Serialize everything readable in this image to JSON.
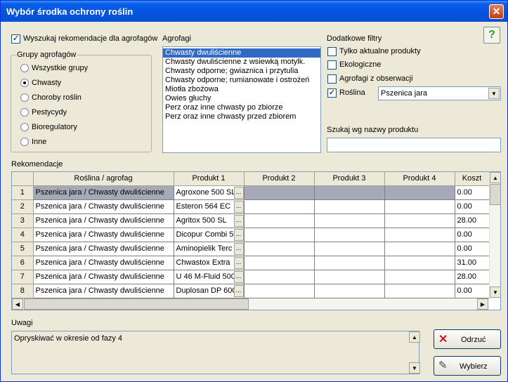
{
  "window": {
    "title": "Wybór środka ochrony roślin",
    "close_glyph": "✕"
  },
  "search_reco_checkbox": {
    "label": "Wyszukaj rekomendacje dla agrofagów",
    "checked": true
  },
  "help_button": {
    "glyph": "?"
  },
  "groups": {
    "title": "Grupy agrofagów",
    "options": [
      {
        "label": "Wszystkie grupy",
        "selected": false
      },
      {
        "label": "Chwasty",
        "selected": true
      },
      {
        "label": "Choroby roślin",
        "selected": false
      },
      {
        "label": "Pestycydy",
        "selected": false
      },
      {
        "label": "Bioregulatory",
        "selected": false
      },
      {
        "label": "Inne",
        "selected": false
      }
    ]
  },
  "agrofagi": {
    "title": "Agrofagi",
    "items": [
      "Chwasty dwuliścienne",
      "Chwasty dwuliścienne z wsiewką motylk.",
      "Chwasty odporne; gwiaznica i przytulia",
      "Chwasty odporne; rumianowate i ostrożeń",
      "Miotła zbożowa",
      "Owies głuchy",
      "Perz oraz inne chwasty po zbiorze",
      "Perz oraz inne chwasty przed zbiorem"
    ],
    "selected_index": 0
  },
  "filters": {
    "title": "Dodatkowe filtry",
    "only_current": {
      "label": "Tylko aktualne produkty",
      "checked": false
    },
    "ecological": {
      "label": "Ekologiczne",
      "checked": false
    },
    "observed": {
      "label": "Agrofagi z obserwacji",
      "checked": false
    },
    "plant": {
      "label": "Roślina",
      "checked": true,
      "value": "Pszenica jara"
    }
  },
  "search_product": {
    "label": "Szukaj wg nazwy produktu",
    "value": ""
  },
  "recommendations": {
    "title": "Rekomendacje",
    "columns": [
      "Roślina / agrofag",
      "Produkt 1",
      "Produkt 2",
      "Produkt 3",
      "Produkt 4",
      "Koszt"
    ],
    "rows": [
      {
        "num": "1",
        "plant": "Pszenica jara / Chwasty dwuliścienne",
        "p1": "Agroxone 500 SL",
        "cost": "0.00"
      },
      {
        "num": "2",
        "plant": "Pszenica jara / Chwasty dwuliścienne",
        "p1": "Esteron 564 EC",
        "cost": "0.00"
      },
      {
        "num": "3",
        "plant": "Pszenica jara / Chwasty dwuliścienne",
        "p1": "Agritox 500 SL",
        "cost": "28.00"
      },
      {
        "num": "4",
        "plant": "Pszenica jara / Chwasty dwuliścienne",
        "p1": "Dicopur Combi 5",
        "cost": "0.00"
      },
      {
        "num": "5",
        "plant": "Pszenica jara / Chwasty dwuliścienne",
        "p1": "Aminopielik Terc",
        "cost": "0.00"
      },
      {
        "num": "6",
        "plant": "Pszenica jara / Chwasty dwuliścienne",
        "p1": "Chwastox Extra",
        "cost": "31.00"
      },
      {
        "num": "7",
        "plant": "Pszenica jara / Chwasty dwuliścienne",
        "p1": "U 46 M-Fluid 500",
        "cost": "28.00"
      },
      {
        "num": "8",
        "plant": "Pszenica jara / Chwasty dwuliścienne",
        "p1": "Duplosan DP 600",
        "cost": "0.00"
      }
    ],
    "ellipsis": "..."
  },
  "notes": {
    "title": "Uwagi",
    "text": "Opryskiwać w okresie od fazy 4"
  },
  "buttons": {
    "reject": "Odrzuć",
    "select": "Wybierz"
  },
  "colors": {
    "title_bar": "#0a5ee8",
    "selection": "#316ac5",
    "window_bg": "#ece9d8",
    "help_green": "#2e9e2e",
    "reject_red": "#d01818"
  }
}
